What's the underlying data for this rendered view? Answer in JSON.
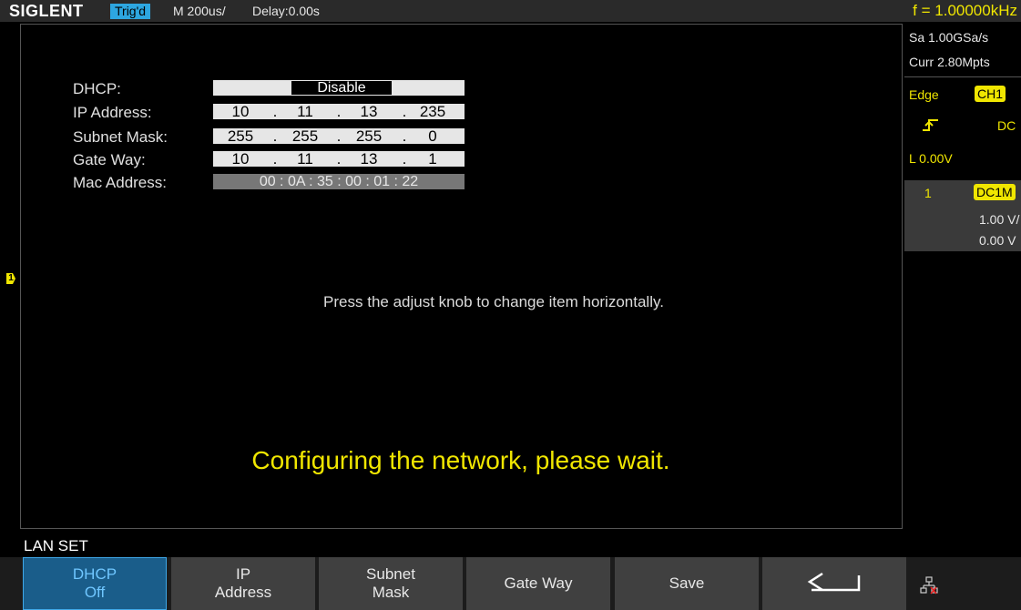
{
  "topbar": {
    "brand": "SIGLENT",
    "trigger_status": "Trig'd",
    "timebase": "M 200us/",
    "delay": "Delay:0.00s",
    "frequency": "f = 1.00000kHz"
  },
  "network": {
    "dhcp_label": "DHCP:",
    "dhcp_value": "Disable",
    "ip_label": "IP Address:",
    "ip": [
      "10",
      "11",
      "13",
      "235"
    ],
    "subnet_label": "Subnet Mask:",
    "subnet": [
      "255",
      "255",
      "255",
      "0"
    ],
    "gateway_label": "Gate Way:",
    "gateway": [
      "10",
      "11",
      "13",
      "1"
    ],
    "mac_label": "Mac Address:",
    "mac": "00 : 0A : 35 : 00 : 01 : 22"
  },
  "messages": {
    "hint": "Press the adjust knob to change item horizontally.",
    "status": "Configuring the network, please wait."
  },
  "right_panel": {
    "sample_rate": "Sa 1.00GSa/s",
    "memory": "Curr 2.80Mpts",
    "trigger_type": "Edge",
    "trigger_source": "CH1",
    "coupling": "DC",
    "level": "L  0.00V",
    "channel_number": "1",
    "channel_coupling": "DC1M",
    "volts_div": "1.00 V/",
    "offset": "0.00 V"
  },
  "channel_marker": "1",
  "menu": {
    "title": "LAN SET",
    "buttons": [
      {
        "line1": "DHCP",
        "line2": "Off"
      },
      {
        "line1": "IP",
        "line2": "Address"
      },
      {
        "line1": "Subnet",
        "line2": "Mask"
      },
      {
        "line1": "Gate Way",
        "line2": ""
      },
      {
        "line1": "Save",
        "line2": ""
      }
    ]
  },
  "icons": [
    "return-arrow-icon",
    "lan-network-icon",
    "rising-edge-icon"
  ],
  "colors": {
    "accent_yellow": "#f0e600",
    "trig_blue": "#2da6e0",
    "active_menu": "#1a5d8a"
  }
}
